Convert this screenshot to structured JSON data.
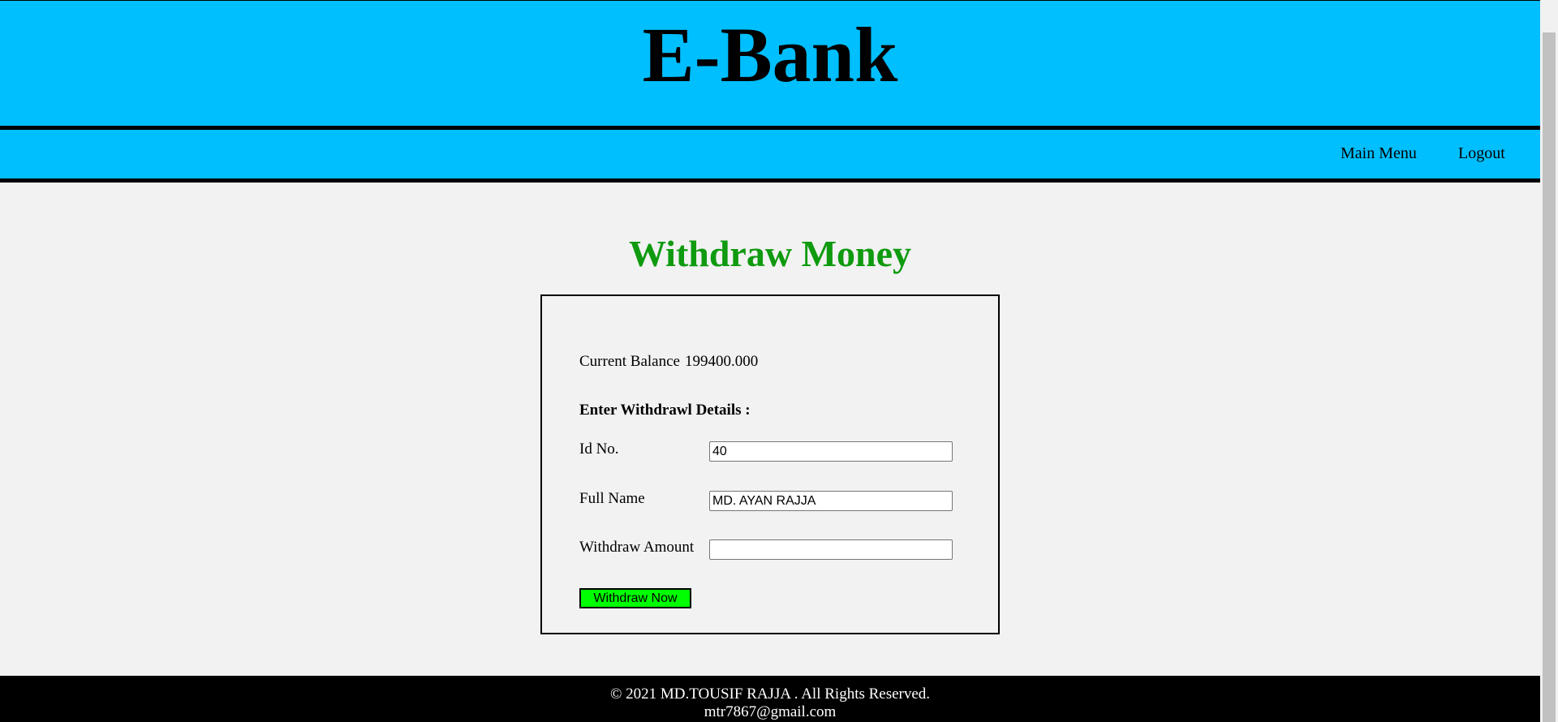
{
  "header": {
    "title": "E-Bank"
  },
  "nav": {
    "main_menu": "Main Menu",
    "logout": "Logout"
  },
  "main": {
    "heading": "Withdraw Money",
    "balance_label": "Current Balance",
    "balance_value": "199400.000",
    "details_heading": "Enter Withdrawl Details :",
    "fields": [
      {
        "label": "Id No.",
        "value": "40",
        "placeholder": ""
      },
      {
        "label": "Full Name",
        "value": "MD. AYAN RAJJA",
        "placeholder": ""
      },
      {
        "label": "Withdraw Amount",
        "value": "",
        "placeholder": ""
      }
    ],
    "submit_label": "Withdraw Now"
  },
  "footer": {
    "copyright": "© 2021 MD.TOUSIF RAJJA . All Rights Reserved.",
    "email": "mtr7867@gmail.com"
  },
  "colors": {
    "header_bg": "#00bfff",
    "heading_green": "#0f9a0f",
    "button_green": "#00ff00",
    "page_bg": "#f2f2f2"
  }
}
